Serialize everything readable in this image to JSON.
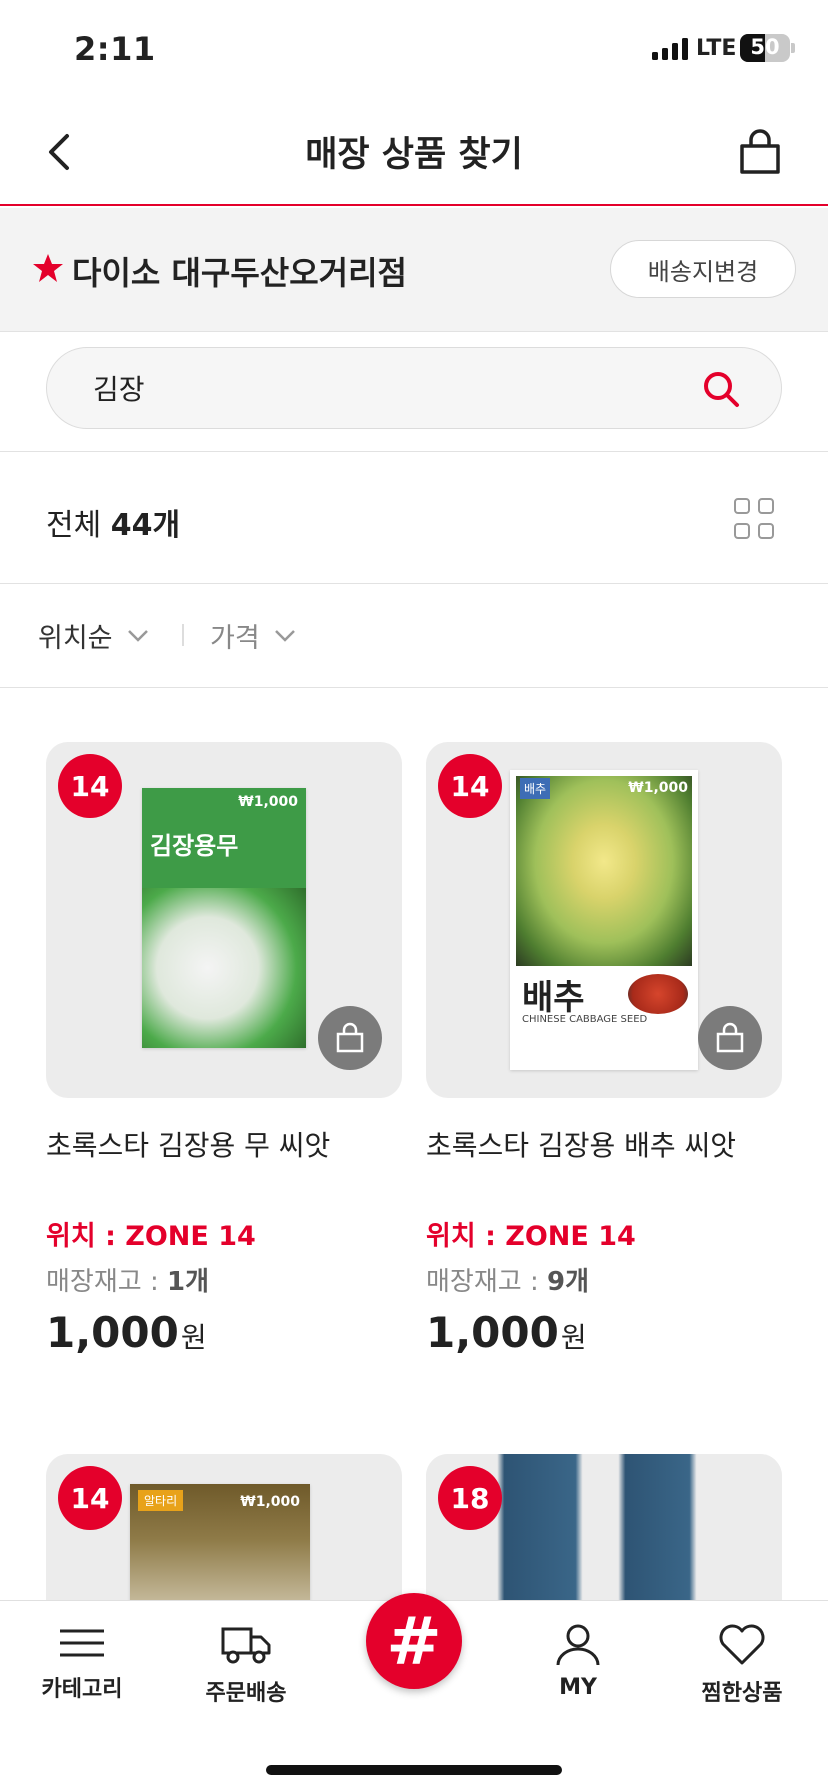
{
  "status_bar": {
    "time": "2:11",
    "network": "LTE",
    "battery": "50"
  },
  "header": {
    "title": "매장 상품 찾기"
  },
  "store": {
    "name": "다이소 대구두산오거리점",
    "change_label": "배송지변경"
  },
  "search": {
    "value": "김장"
  },
  "results": {
    "label": "전체",
    "count": "44개"
  },
  "sort": {
    "location": "위치순",
    "price": "가격"
  },
  "products": [
    {
      "zone_badge": "14",
      "name": "초록스타 김장용 무 씨앗",
      "location": "위치 : ZONE 14",
      "stock_label": "매장재고 : ",
      "stock_value": "1개",
      "price": "1,000",
      "currency": "원",
      "pkg_title": "김장용무",
      "pkg_price": "₩1,000"
    },
    {
      "zone_badge": "14",
      "name": "초록스타 김장용 배추 씨앗",
      "location": "위치 : ZONE 14",
      "stock_label": "매장재고 : ",
      "stock_value": "9개",
      "price": "1,000",
      "currency": "원",
      "pkg_title": "배추",
      "pkg_sub": "CHINESE CABBAGE SEED",
      "pkg_price": "₩1,000",
      "pkg_tag": "배추"
    },
    {
      "zone_badge": "14",
      "pkg_tag": "알타리",
      "pkg_price": "₩1,000"
    },
    {
      "zone_badge": "18"
    }
  ],
  "bottom_nav": {
    "category": "카테고리",
    "order": "주문배송",
    "hashtag": "#",
    "my": "MY",
    "wishlist": "찜한상품"
  },
  "colors": {
    "accent": "#e4002b"
  }
}
